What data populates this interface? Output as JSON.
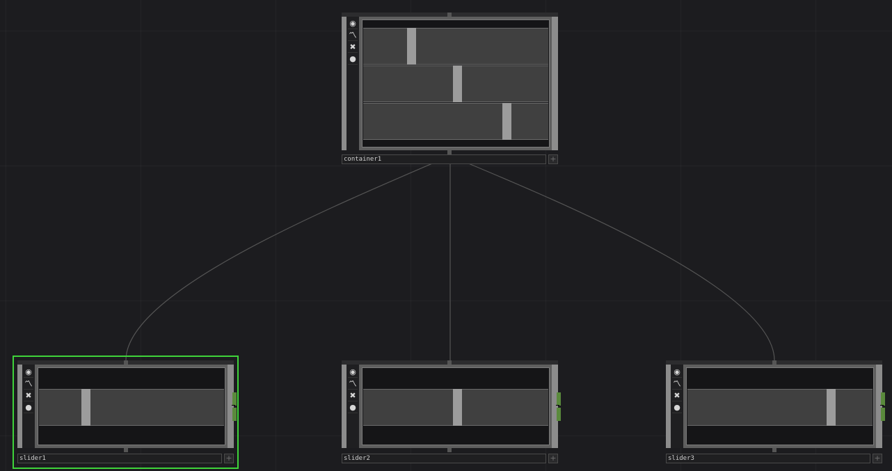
{
  "network": {
    "operators": [
      {
        "id": "container1",
        "name": "container1",
        "type": "container",
        "selected": false,
        "slider_values": [
          0.25,
          0.51,
          0.79
        ],
        "tools": [
          "viewer-active-icon",
          "bypass-icon",
          "delete-icon",
          "lock-icon"
        ],
        "add_symbol": "+"
      },
      {
        "id": "slider1",
        "name": "slider1",
        "type": "slider",
        "selected": true,
        "slider_values": [
          0.24
        ],
        "tools": [
          "viewer-active-icon",
          "bypass-icon",
          "delete-icon",
          "lock-icon"
        ],
        "add_symbol": "+"
      },
      {
        "id": "slider2",
        "name": "slider2",
        "type": "slider",
        "selected": false,
        "slider_values": [
          0.51
        ],
        "tools": [
          "viewer-active-icon",
          "bypass-icon",
          "delete-icon",
          "lock-icon"
        ],
        "add_symbol": "+"
      },
      {
        "id": "slider3",
        "name": "slider3",
        "type": "slider",
        "selected": false,
        "slider_values": [
          0.79
        ],
        "tools": [
          "viewer-active-icon",
          "bypass-icon",
          "delete-icon",
          "lock-icon"
        ],
        "add_symbol": "+"
      }
    ],
    "connections": [
      {
        "from": "container1",
        "to": "slider1"
      },
      {
        "from": "container1",
        "to": "slider2"
      },
      {
        "from": "container1",
        "to": "slider3"
      }
    ],
    "colors": {
      "background": "#1c1c1f",
      "selection": "#3fd43a",
      "output_active": "#5a8a3c",
      "wire": "#555555"
    },
    "tool_glyphs": {
      "viewer-active-icon": "◉",
      "bypass-icon": "〽",
      "delete-icon": "✖",
      "lock-icon": "●"
    }
  }
}
